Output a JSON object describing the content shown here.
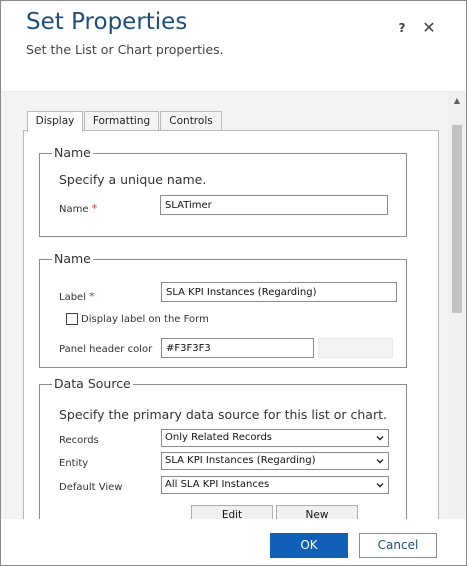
{
  "header": {
    "title": "Set Properties",
    "subtitle": "Set the List or Chart properties.",
    "help_label": "?",
    "close_label": "✕"
  },
  "tabs": [
    {
      "label": "Display",
      "active": true
    },
    {
      "label": "Formatting",
      "active": false
    },
    {
      "label": "Controls",
      "active": false
    }
  ],
  "name_section": {
    "legend": "Name",
    "instruction": "Specify a unique name.",
    "name_label": "Name",
    "required_mark": "*",
    "name_value": "SLATimer"
  },
  "label_section": {
    "legend": "Name",
    "label_label": "Label",
    "required_mark": "*",
    "label_value": "SLA KPI Instances (Regarding)",
    "display_label_checkbox": "Display label on the Form",
    "display_label_checked": false,
    "panel_header_color_label": "Panel header color",
    "panel_header_color_value": "#F3F3F3"
  },
  "data_source": {
    "legend": "Data Source",
    "instruction": "Specify the primary data source for this list or chart.",
    "records_label": "Records",
    "records_value": "Only Related Records",
    "entity_label": "Entity",
    "entity_value": "SLA KPI Instances (Regarding)",
    "default_view_label": "Default View",
    "default_view_value": "All SLA KPI Instances",
    "edit_button": "Edit",
    "new_button": "New"
  },
  "footer": {
    "ok_button": "OK",
    "cancel_button": "Cancel"
  },
  "colors": {
    "title": "#1f4e79",
    "primary_button": "#1160b7",
    "required": "#c0392b",
    "content_background": "#f3f3f3"
  },
  "icons": {
    "help": "question-icon",
    "close": "close-icon",
    "dropdown": "chevron-down-icon",
    "scroll_up": "triangle-up-icon"
  }
}
